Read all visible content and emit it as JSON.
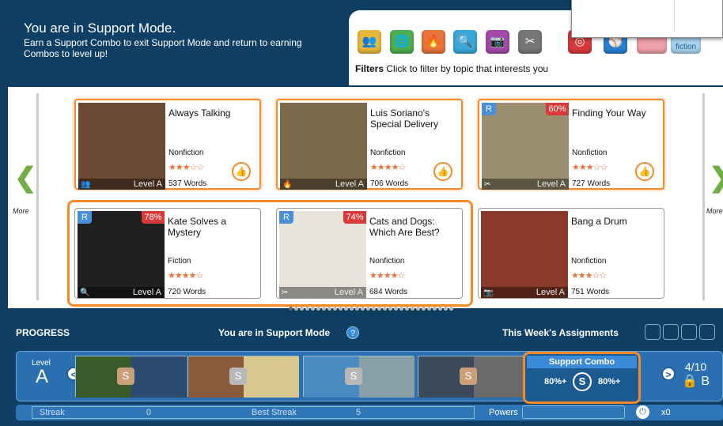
{
  "header": {
    "title": "You are in Support Mode.",
    "description": "Earn a Support Combo to exit Support Mode and return to earning Combos to level up!"
  },
  "filters": {
    "label_bold": "Filters",
    "label_text": "Click to filter by topic that interests you",
    "icons": [
      {
        "name": "people-icon",
        "color": "#e8b73a",
        "glyph": "👥"
      },
      {
        "name": "globe-icon",
        "color": "#4caf50",
        "glyph": "🌐"
      },
      {
        "name": "flame-icon",
        "color": "#e8743b",
        "glyph": "🔥"
      },
      {
        "name": "magnifier-icon",
        "color": "#3aa7d8",
        "glyph": "🔍"
      },
      {
        "name": "camera-icon",
        "color": "#a44aa8",
        "glyph": "📷"
      },
      {
        "name": "tools-icon",
        "color": "#777777",
        "glyph": "✂"
      },
      {
        "name": "target-icon",
        "color": "#d83a3a",
        "glyph": "◎"
      },
      {
        "name": "sports-icon",
        "color": "#2a7fd0",
        "glyph": "⚾"
      }
    ],
    "fiction_label": "Fiction",
    "nonfiction_label": "fiction"
  },
  "nav": {
    "more_left": "More",
    "more_right": "More"
  },
  "books": [
    {
      "title": "Always Talking",
      "genre": "Nonfiction",
      "stars": "★★★☆☆",
      "words": "537 Words",
      "level": "Level A",
      "thumb": "👍",
      "category_glyph": "👥",
      "category_color": "#e8b73a",
      "img_bg": "#6b4a35"
    },
    {
      "title": "Luis Soriano's Special Delivery",
      "genre": "Nonfiction",
      "stars": "★★★★☆",
      "words": "706 Words",
      "level": "Level A",
      "thumb": "👍",
      "category_glyph": "🔥",
      "category_color": "#e8743b",
      "img_bg": "#7a6a4a"
    },
    {
      "title": "Finding Your Way",
      "genre": "Nonfiction",
      "stars": "★★★☆☆",
      "words": "727 Words",
      "level": "Level A",
      "thumb": "👍",
      "category_glyph": "✂",
      "category_color": "#777777",
      "img_bg": "#9a8e6e",
      "rbadge": "R",
      "pct": "60%"
    },
    {
      "title": "Kate Solves a Mystery",
      "genre": "Fiction",
      "stars": "★★★★☆",
      "words": "720 Words",
      "level": "Level A",
      "category_glyph": "🔍",
      "category_color": "#3aa7d8",
      "img_bg": "#202020",
      "rbadge": "R",
      "pct": "78%"
    },
    {
      "title": "Cats and Dogs: Which Are Best?",
      "genre": "Nonfiction",
      "stars": "★★★★☆",
      "words": "684 Words",
      "level": "Level A",
      "category_glyph": "✂",
      "category_color": "#777777",
      "img_bg": "#e8e4dc",
      "rbadge": "R",
      "pct": "74%"
    },
    {
      "title": "Bang a Drum",
      "genre": "Nonfiction",
      "stars": "★★★☆☆",
      "words": "751 Words",
      "level": "Level A",
      "category_glyph": "📷",
      "category_color": "#a44aa8",
      "img_bg": "#8a3a2a"
    }
  ],
  "progress": {
    "label": "PROGRESS",
    "support_mode": "You are in Support Mode",
    "help": "?",
    "assignments": "This Week's Assignments",
    "level_label": "Level",
    "level_value": "A",
    "combo_title": "Support Combo",
    "combo_left": "80%+",
    "combo_s": "S",
    "combo_right": "80%+",
    "next_count": "4/10",
    "next_level": "B",
    "nav_prev": "<",
    "nav_next": ">",
    "slot_glyph": "S"
  },
  "streak": {
    "label": "Streak",
    "value": "0",
    "best_label": "Best Streak",
    "best_value": "5",
    "powers_label": "Powers",
    "powers_count": "x0",
    "power_glyph": "⏻"
  }
}
